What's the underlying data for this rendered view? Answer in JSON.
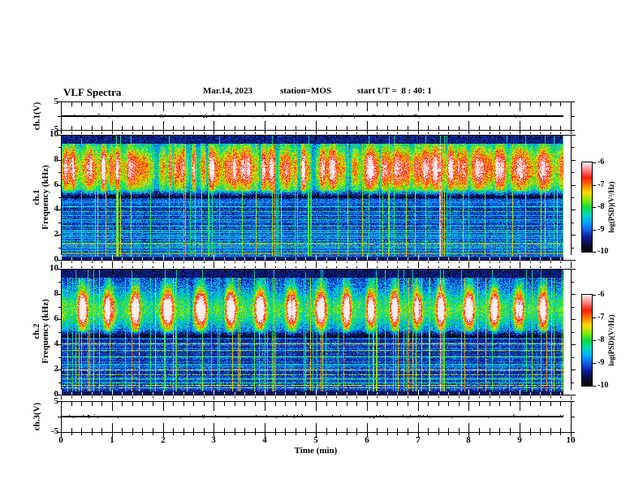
{
  "header": {
    "title": "VLF Spectra",
    "date": "Mar.14, 2023",
    "station": "station=MOS",
    "start_ut": "start UT =  8 : 40: 1"
  },
  "axis_labels": {
    "time": "Time (min)",
    "ch1_strip": "ch.1(V)",
    "ch1_spec_line1": "ch.1",
    "ch1_spec_line2": "Frequency (kHz)",
    "ch2_spec_line1": "ch.2",
    "ch2_spec_line2": "Frequency (kHz)",
    "ch3_strip": "ch.3(V)"
  },
  "ticks": {
    "x_labels": [
      "0",
      "1",
      "2",
      "3",
      "4",
      "5",
      "6",
      "7",
      "8",
      "9",
      "10"
    ],
    "spec_y_labels": [
      "10",
      "8",
      "6",
      "4",
      "2",
      "0"
    ],
    "strip_y_labels": [
      "5",
      "-5"
    ]
  },
  "colorbar": {
    "label": "log(PSD)(V²/Hz)",
    "tick_labels": [
      "-6",
      "-7",
      "-8",
      "-9",
      "-10"
    ],
    "colormap": [
      "#050508",
      "#08103c",
      "#0a1ea0",
      "#1464e6",
      "#00aaff",
      "#00dcb4",
      "#14dc3c",
      "#8ce614",
      "#ffdc00",
      "#ff7800",
      "#ff1e0a",
      "#ff8282",
      "#ffeded"
    ]
  },
  "chart_data": {
    "type": "multi-panel",
    "x_axis": {
      "label": "Time (min)",
      "range": [
        0,
        10
      ],
      "major_tick_step": 1,
      "data_end_min": 9.84
    },
    "colorbar": {
      "label": "log(PSD)(V²/Hz)",
      "range": [
        -10,
        -6
      ]
    },
    "panels": [
      {
        "type": "line",
        "channel": "ch.1",
        "ylabel": "ch.1(V)",
        "ylim": [
          -5,
          5
        ],
        "trace": "flat trace at ≈0 V for the whole ≈9.8 min record with tiny impulsive blips"
      },
      {
        "type": "heatmap",
        "channel": "ch.1",
        "ylabel": "Frequency (kHz)",
        "ylim": [
          0,
          10
        ],
        "zlim": [
          -10,
          -6
        ],
        "features": {
          "broadband_emission_khz": [
            5.0,
            9.35
          ],
          "peak_khz": 7.3,
          "structure": "dense vertical burst striations, red cores (≈-6.5 to -7) between ~6 and 9 kHz",
          "quiet_above_khz": 9.4,
          "harmonic_lines_khz": [
            4.65,
            4.3,
            3.95,
            3.6,
            3.3,
            3.0,
            2.72,
            2.45,
            2.2,
            1.97,
            1.75,
            1.55,
            1.37,
            1.2,
            1.05,
            0.9,
            0.78,
            0.62,
            0.3
          ],
          "warm_lines_khz": [
            1.3,
            0.55
          ],
          "sferic_vertical_lines": "numerous full-height green impulses; strong white event at ≈7.45 min"
        }
      },
      {
        "type": "heatmap",
        "channel": "ch.2",
        "ylabel": "Frequency (kHz)",
        "ylim": [
          0,
          10
        ],
        "zlim": [
          -10,
          -6
        ],
        "features": {
          "broadband_emission_khz": [
            4.7,
            9.4
          ],
          "peak_khz": 6.8,
          "structure": "quasi-periodic red emission blobs, period ≈0.5–0.6 min, between ~5 and 9 kHz",
          "quiet_above_khz": 9.4,
          "harmonic_lines_khz": [
            4.6,
            4.1,
            3.55,
            3.05,
            2.5,
            2.0,
            1.6,
            1.3,
            1.0,
            0.8,
            0.6
          ],
          "sferic_vertical_lines": "numerous full-height green impulses; strong white event at ≈7.45 min"
        }
      },
      {
        "type": "line",
        "channel": "ch.3",
        "ylabel": "ch.3(V)",
        "ylim": [
          -5,
          5
        ],
        "trace": "flat trace at ≈0 V with sparse tiny spikes"
      }
    ]
  }
}
